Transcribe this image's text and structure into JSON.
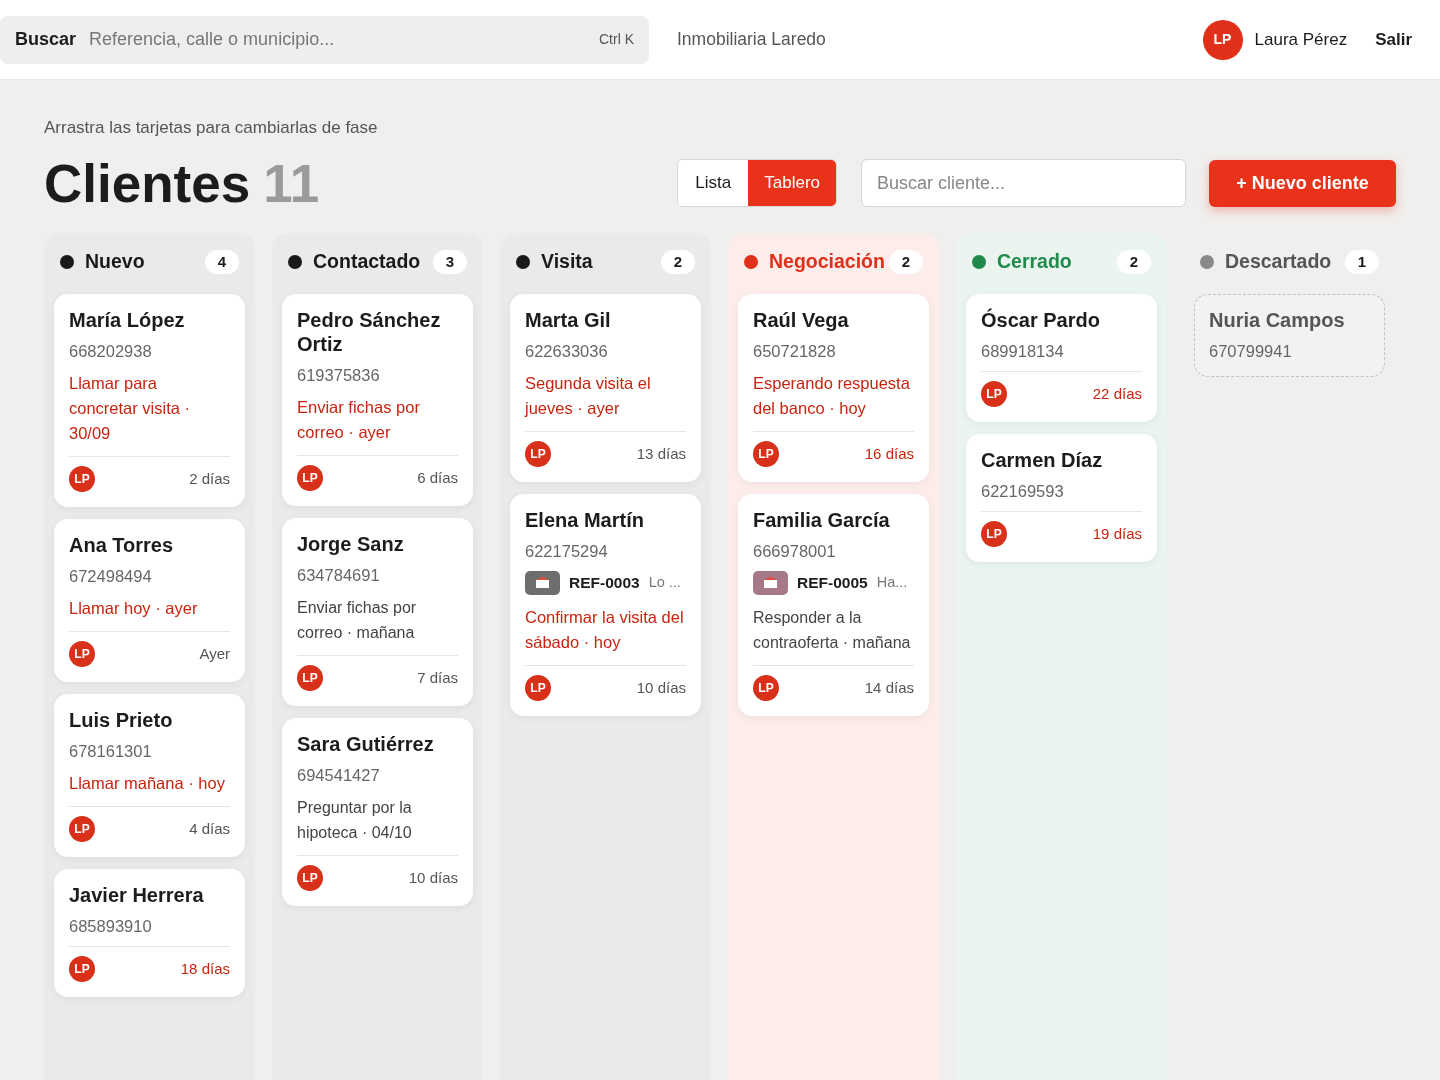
{
  "top_bar": {
    "search": {
      "label": "Buscar",
      "placeholder": "Referencia, calle o municipio...",
      "shortcut": "Ctrl K"
    },
    "company": "Inmobiliaria Laredo",
    "user": {
      "initials": "LP",
      "name": "Laura Pérez"
    },
    "logout": "Salir"
  },
  "header": {
    "subtitle": "Arrastra las tarjetas para cambiarlas de fase",
    "title": "Clientes",
    "count": "11",
    "views": [
      {
        "label": "Lista",
        "selected": false
      },
      {
        "label": "Tablero",
        "selected": true
      }
    ],
    "search": {
      "placeholder": "Buscar cliente..."
    },
    "new_button": "+ Nuevo cliente"
  },
  "columns": [
    {
      "title": "Nuevo",
      "count": "4",
      "color": "#1a1a1a",
      "kind": "active",
      "cards": [
        {
          "name": "María López",
          "phone": "668202938",
          "task": {
            "text": "Llamar para concretar visita · 30/09",
            "overdue": true
          },
          "owner": "LP",
          "age": {
            "text": "2 días",
            "stale": false
          }
        },
        {
          "name": "Ana Torres",
          "phone": "672498494",
          "task": {
            "text": "Llamar hoy · ayer",
            "overdue": true
          },
          "owner": "LP",
          "age": {
            "text": "Ayer",
            "stale": false
          }
        },
        {
          "name": "Luis Prieto",
          "phone": "678161301",
          "task": {
            "text": "Llamar mañana · hoy",
            "overdue": true
          },
          "owner": "LP",
          "age": {
            "text": "4 días",
            "stale": false
          }
        },
        {
          "name": "Javier Herrera",
          "phone": "685893910",
          "owner": "LP",
          "age": {
            "text": "18 días",
            "stale": true
          }
        }
      ]
    },
    {
      "title": "Contactado",
      "count": "3",
      "color": "#1a1a1a",
      "kind": "active",
      "cards": [
        {
          "name": "Pedro Sánchez Ortiz",
          "phone": "619375836",
          "task": {
            "text": "Enviar fichas por correo · ayer",
            "overdue": true
          },
          "owner": "LP",
          "age": {
            "text": "6 días",
            "stale": false
          }
        },
        {
          "name": "Jorge Sanz",
          "phone": "634784691",
          "task": {
            "text": "Enviar fichas por correo · mañana",
            "overdue": false
          },
          "owner": "LP",
          "age": {
            "text": "7 días",
            "stale": false
          }
        },
        {
          "name": "Sara Gutiérrez",
          "phone": "694541427",
          "task": {
            "text": "Preguntar por la hipoteca · 04/10",
            "overdue": false
          },
          "owner": "LP",
          "age": {
            "text": "10 días",
            "stale": false
          }
        }
      ]
    },
    {
      "title": "Visita",
      "count": "2",
      "color": "#1a1a1a",
      "kind": "active",
      "cards": [
        {
          "name": "Marta Gil",
          "phone": "622633036",
          "task": {
            "text": "Segunda visita el jueves · ayer",
            "overdue": true
          },
          "owner": "LP",
          "age": {
            "text": "13 días",
            "stale": false
          }
        },
        {
          "name": "Elena Martín",
          "phone": "622175294",
          "property": {
            "ref": "REF-0003",
            "note": "Lo ...",
            "color": "#6e6e6e"
          },
          "task": {
            "text": "Confirmar la visita del sábado · hoy",
            "overdue": true
          },
          "owner": "LP",
          "age": {
            "text": "10 días",
            "stale": false
          }
        }
      ]
    },
    {
      "title": "Negociación",
      "count": "2",
      "color": "#e0301a",
      "kind": "active",
      "cards": [
        {
          "name": "Raúl Vega",
          "phone": "650721828",
          "task": {
            "text": "Esperando respuesta del banco · hoy",
            "overdue": true
          },
          "owner": "LP",
          "age": {
            "text": "16 días",
            "stale": true
          }
        },
        {
          "name": "Familia García",
          "phone": "666978001",
          "property": {
            "ref": "REF-0005",
            "note": "Ha...",
            "color": "#a6788a"
          },
          "task": {
            "text": "Responder a la contraoferta · mañana",
            "overdue": false
          },
          "owner": "LP",
          "age": {
            "text": "14 días",
            "stale": false
          }
        }
      ]
    },
    {
      "title": "Cerrado",
      "count": "2",
      "color": "#1f8a4c",
      "kind": "active",
      "cards": [
        {
          "name": "Óscar Pardo",
          "phone": "689918134",
          "owner": "LP",
          "age": {
            "text": "22 días",
            "stale": true
          }
        },
        {
          "name": "Carmen Díaz",
          "phone": "622169593",
          "owner": "LP",
          "age": {
            "text": "19 días",
            "stale": true
          }
        }
      ]
    },
    {
      "title": "Descartado",
      "count": "1",
      "color": "#8a8a8a",
      "kind": "discarded",
      "cards": [
        {
          "name": "Nuria Campos",
          "phone": "670799941"
        }
      ]
    }
  ]
}
